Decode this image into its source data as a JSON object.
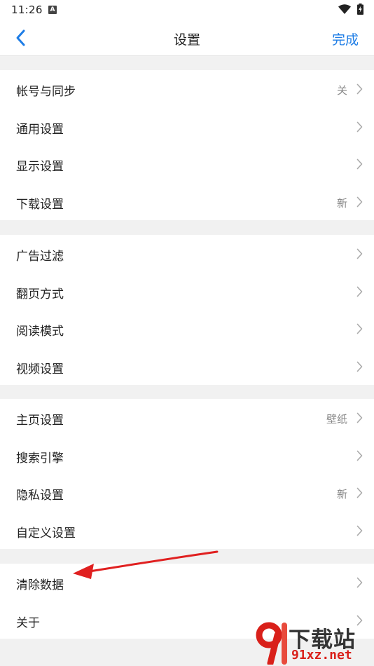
{
  "status_bar": {
    "time": "11:26",
    "a_icon": "A"
  },
  "nav": {
    "title": "设置",
    "done_label": "完成"
  },
  "groups": [
    {
      "items": [
        {
          "label": "帐号与同步",
          "value": "关"
        },
        {
          "label": "通用设置",
          "value": ""
        },
        {
          "label": "显示设置",
          "value": ""
        },
        {
          "label": "下载设置",
          "value": "新"
        }
      ]
    },
    {
      "items": [
        {
          "label": "广告过滤",
          "value": ""
        },
        {
          "label": "翻页方式",
          "value": ""
        },
        {
          "label": "阅读模式",
          "value": ""
        },
        {
          "label": "视频设置",
          "value": ""
        }
      ]
    },
    {
      "items": [
        {
          "label": "主页设置",
          "value": "壁纸"
        },
        {
          "label": "搜索引擎",
          "value": ""
        },
        {
          "label": "隐私设置",
          "value": "新"
        },
        {
          "label": "自定义设置",
          "value": ""
        }
      ]
    },
    {
      "items": [
        {
          "label": "清除数据",
          "value": ""
        },
        {
          "label": "关于",
          "value": ""
        }
      ]
    }
  ],
  "watermark": {
    "text": "下载站",
    "url": "91xz.net"
  },
  "colors": {
    "accent": "#1e7de6",
    "annotation": "#e02020",
    "background": "#f1f1f1"
  }
}
